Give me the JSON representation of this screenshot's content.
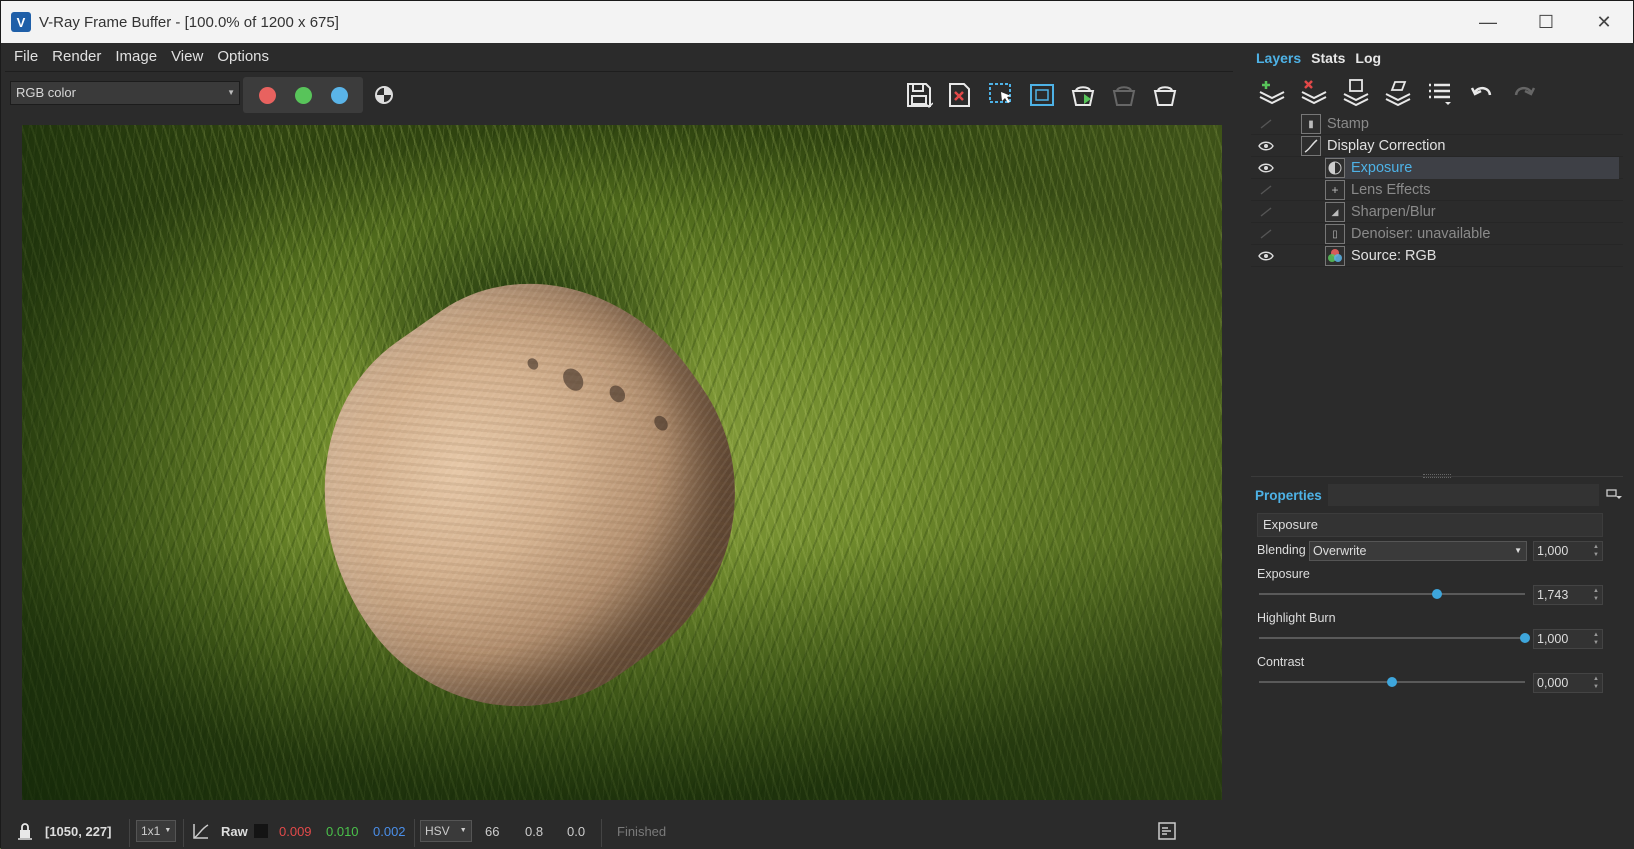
{
  "window": {
    "title": "V-Ray Frame Buffer - [100.0% of 1200 x 675]",
    "app_icon_glyph": "V",
    "controls": {
      "minimize": "—",
      "maximize": "☐",
      "close": "✕"
    }
  },
  "menu": [
    "File",
    "Render",
    "Image",
    "View",
    "Options"
  ],
  "toolbar": {
    "channel": "RGB color",
    "rgb_colors": {
      "red": "#e8625f",
      "green": "#58c45a",
      "blue": "#5ab4e8"
    },
    "icons": [
      "save-image-icon",
      "clear-image-icon",
      "region-render-icon",
      "track-mouse-icon",
      "render-last-icon",
      "interactive-render-icon",
      "stop-render-icon"
    ]
  },
  "statusbar": {
    "coords": "[1050, 227]",
    "zoom_select": "1x1",
    "raw_label": "Raw",
    "r_value": "0.009",
    "g_value": "0.010",
    "b_value": "0.002",
    "color_mode": "HSV",
    "h_value": "66",
    "s_value": "0.8",
    "v_value": "0.0",
    "status": "Finished",
    "colors": {
      "r": "#e24a4a",
      "g": "#4ac04a",
      "b": "#4a8ee8"
    }
  },
  "right_tabs": [
    "Layers",
    "Stats",
    "Log"
  ],
  "layers": [
    {
      "label": "Stamp",
      "visible": false,
      "indent": 0,
      "icon": "stamp-icon",
      "dim": true
    },
    {
      "label": "Display Correction",
      "visible": true,
      "indent": 0,
      "icon": "curve-icon",
      "dim": false
    },
    {
      "label": "Exposure",
      "visible": true,
      "indent": 1,
      "icon": "exposure-icon",
      "dim": false,
      "selected": true
    },
    {
      "label": "Lens Effects",
      "visible": false,
      "indent": 1,
      "icon": "lens-icon",
      "dim": true
    },
    {
      "label": "Sharpen/Blur",
      "visible": false,
      "indent": 1,
      "icon": "sharpen-icon",
      "dim": true
    },
    {
      "label": "Denoiser: unavailable",
      "visible": false,
      "indent": 1,
      "icon": "denoiser-icon",
      "dim": true
    },
    {
      "label": "Source: RGB",
      "visible": true,
      "indent": 1,
      "icon": "source-rgb-icon",
      "dim": false
    }
  ],
  "properties": {
    "title": "Properties",
    "layer_name": "Exposure",
    "blending_label": "Blending",
    "blending_mode": "Overwrite",
    "blending_value": "1,000",
    "exposure_label": "Exposure",
    "exposure_value": "1,743",
    "exposure_pos": 0.67,
    "highlight_label": "Highlight Burn",
    "highlight_value": "1,000",
    "highlight_pos": 1.0,
    "contrast_label": "Contrast",
    "contrast_value": "0,000",
    "contrast_pos": 0.5
  }
}
